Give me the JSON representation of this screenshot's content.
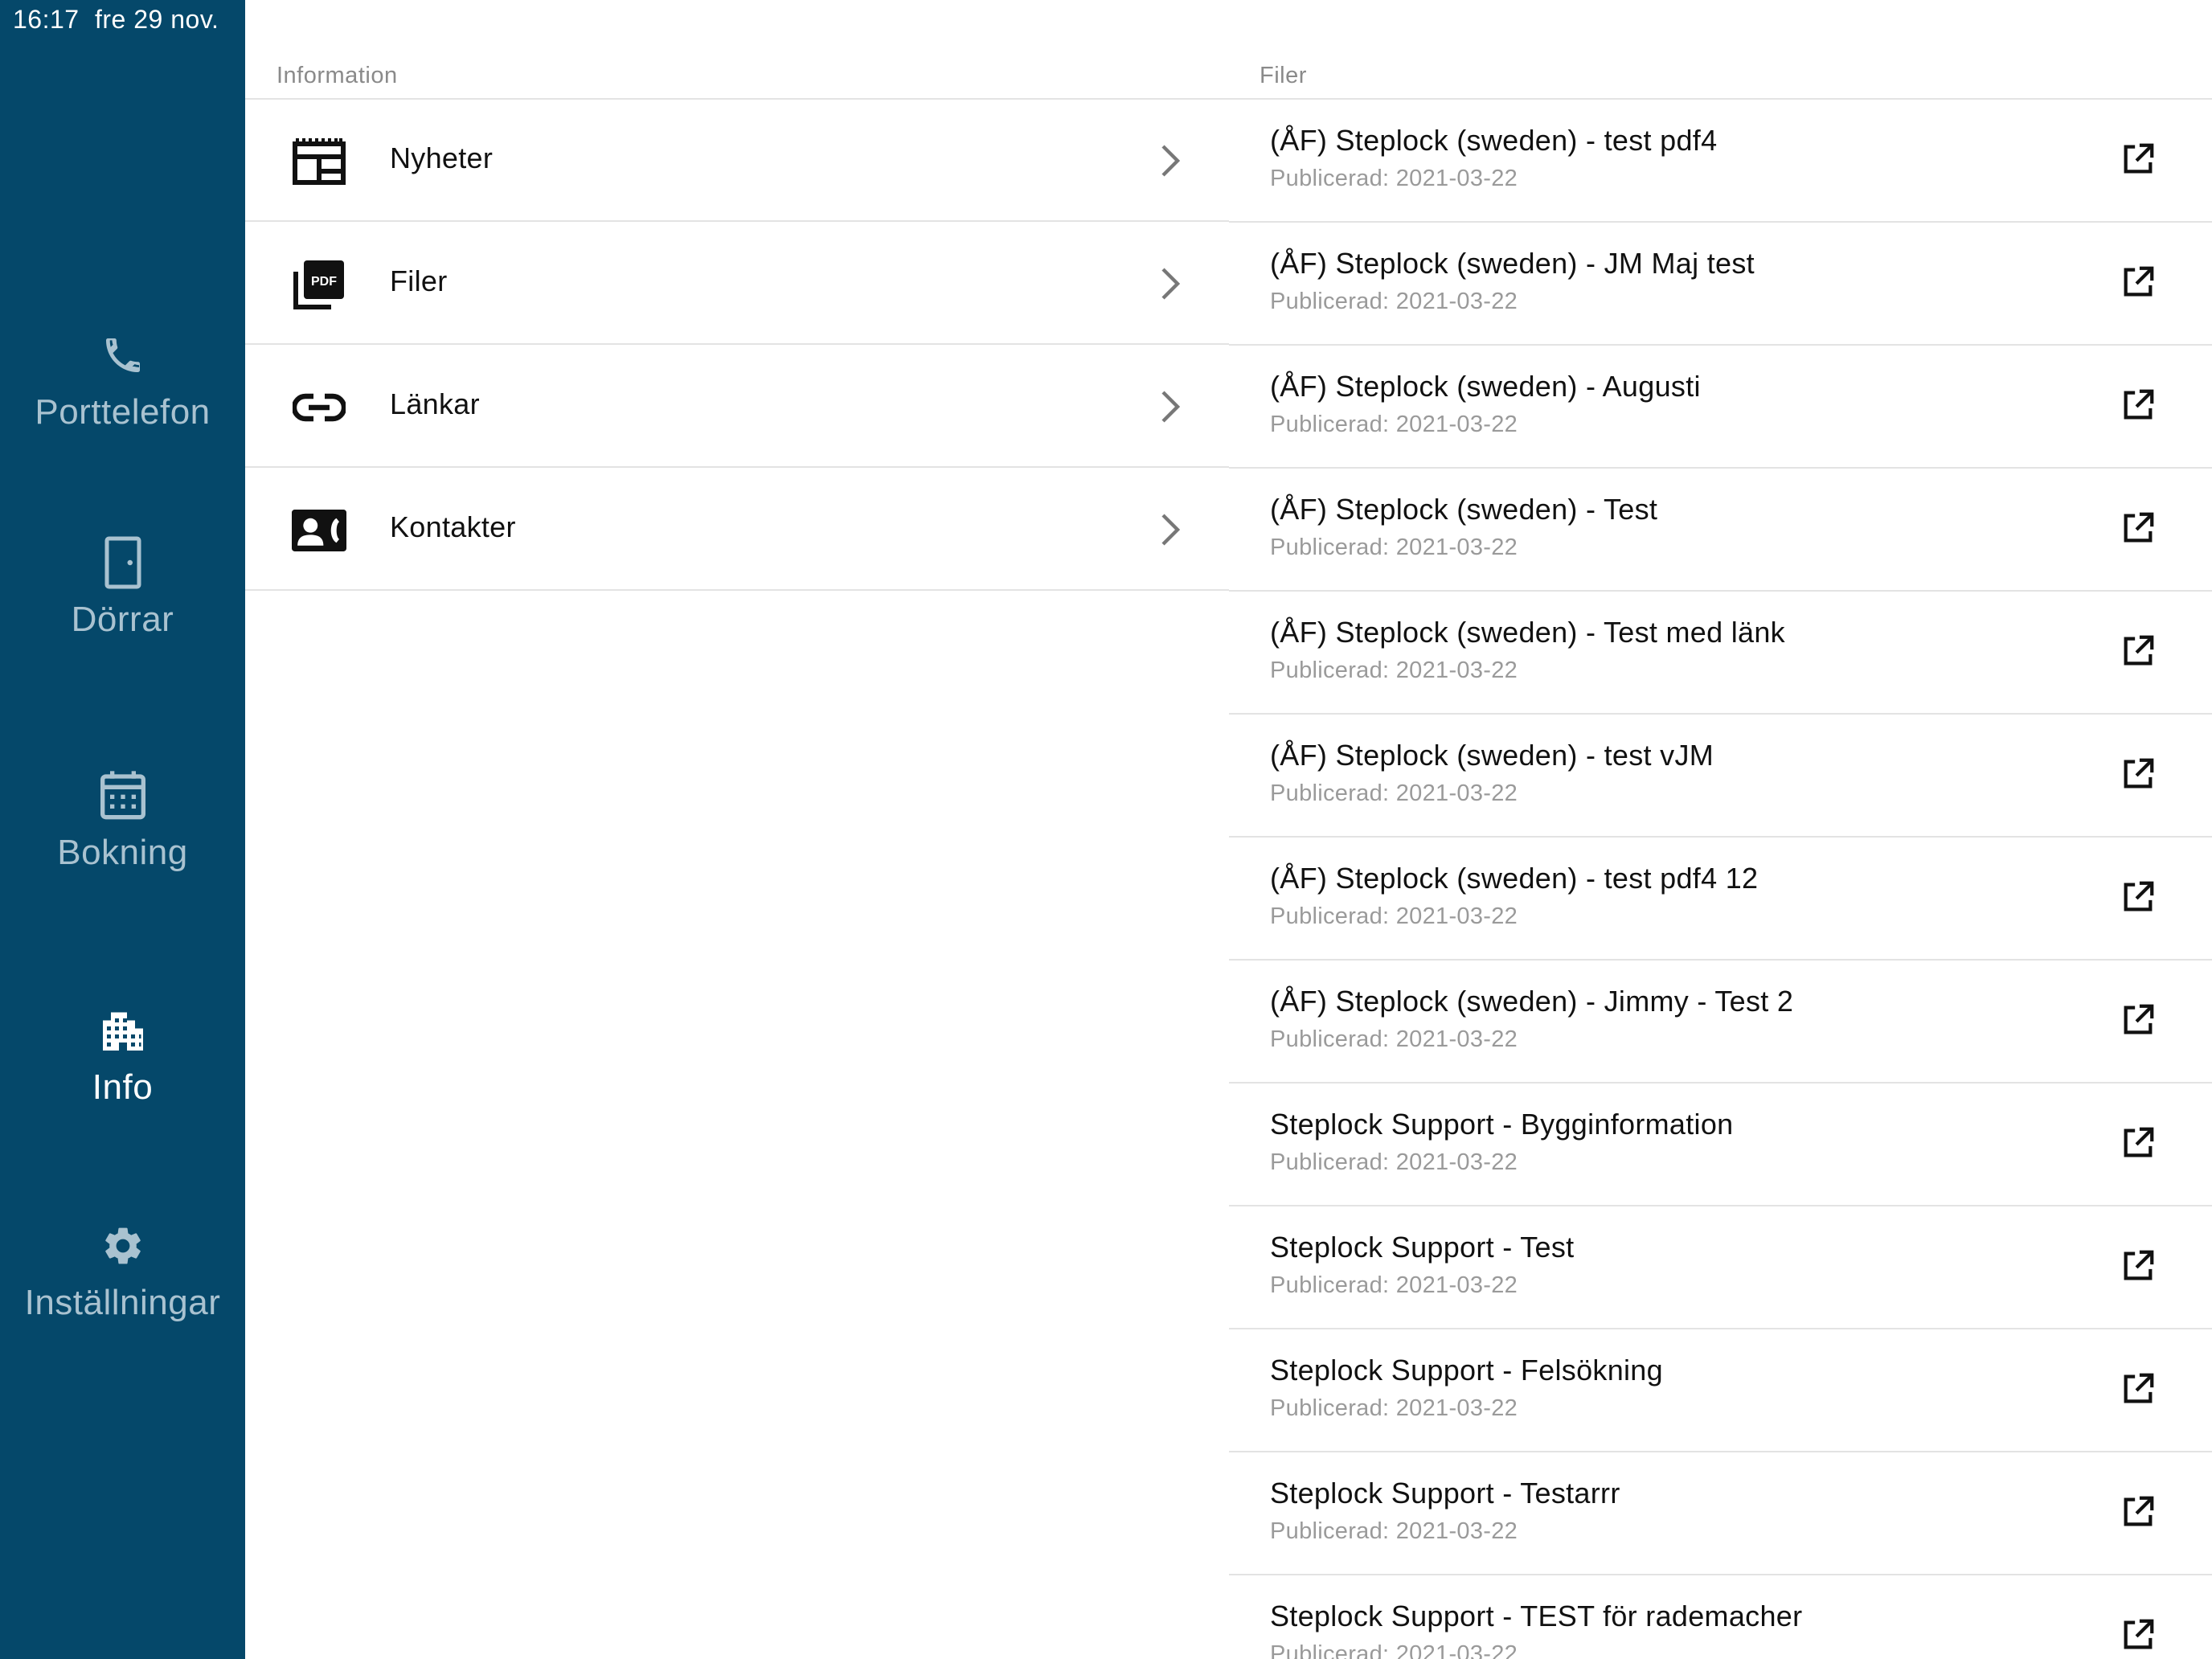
{
  "status_bar": {
    "time": "16:17",
    "date": "fre 29 nov."
  },
  "sidebar": {
    "items": [
      {
        "label": "Porttelefon",
        "icon": "phone-icon",
        "active": false
      },
      {
        "label": "Dörrar",
        "icon": "door-icon",
        "active": false
      },
      {
        "label": "Bokning",
        "icon": "calendar-icon",
        "active": false
      },
      {
        "label": "Info",
        "icon": "building-icon",
        "active": true
      },
      {
        "label": "Inställningar",
        "icon": "gear-icon",
        "active": false
      }
    ]
  },
  "information": {
    "header": "Information",
    "items": [
      {
        "label": "Nyheter",
        "icon": "news-icon"
      },
      {
        "label": "Filer",
        "icon": "pdf-icon"
      },
      {
        "label": "Länkar",
        "icon": "link-icon"
      },
      {
        "label": "Kontakter",
        "icon": "contact-card-icon"
      }
    ]
  },
  "files": {
    "header": "Filer",
    "items": [
      {
        "title": "(ÅF) Steplock (sweden) - test pdf4",
        "published": "Publicerad: 2021-03-22"
      },
      {
        "title": "(ÅF) Steplock (sweden) - JM Maj test",
        "published": "Publicerad: 2021-03-22"
      },
      {
        "title": "(ÅF) Steplock (sweden) - Augusti",
        "published": "Publicerad: 2021-03-22"
      },
      {
        "title": "(ÅF) Steplock (sweden) - Test",
        "published": "Publicerad: 2021-03-22"
      },
      {
        "title": "(ÅF) Steplock (sweden) - Test med länk",
        "published": "Publicerad: 2021-03-22"
      },
      {
        "title": "(ÅF) Steplock (sweden) - test vJM",
        "published": "Publicerad: 2021-03-22"
      },
      {
        "title": "(ÅF) Steplock (sweden) - test pdf4 12",
        "published": "Publicerad: 2021-03-22"
      },
      {
        "title": "(ÅF) Steplock (sweden) - Jimmy - Test 2",
        "published": "Publicerad: 2021-03-22"
      },
      {
        "title": "Steplock Support - Bygginformation",
        "published": "Publicerad: 2021-03-22"
      },
      {
        "title": "Steplock Support - Test",
        "published": "Publicerad: 2021-03-22"
      },
      {
        "title": "Steplock Support - Felsökning",
        "published": "Publicerad: 2021-03-22"
      },
      {
        "title": "Steplock Support - Testarrr",
        "published": "Publicerad: 2021-03-22"
      },
      {
        "title": "Steplock Support - TEST för rademacher",
        "published": "Publicerad: 2021-03-22"
      }
    ]
  },
  "colors": {
    "sidebar_bg": "#05486a",
    "sidebar_text": "#a9c2d0",
    "sidebar_active_text": "#ffffff",
    "status_indicator": "#2ecc40",
    "divider": "#e3e3e3",
    "secondary_text": "#9a9a9a"
  }
}
